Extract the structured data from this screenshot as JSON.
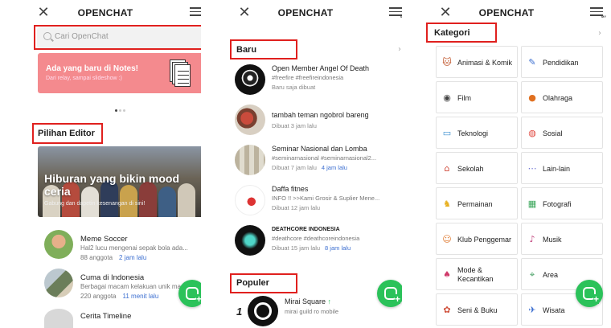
{
  "app_title": "OPENCHAT",
  "menu_badge": "MY",
  "close_glyph": "✕",
  "colors": {
    "accent_green": "#2bc25a",
    "banner_pink": "#f48a8e",
    "link_blue": "#3b6ed0",
    "highlight_red": "#e0201e"
  },
  "panel1": {
    "search_placeholder": "Cari OpenChat",
    "banner_title": "Ada yang baru di Notes!",
    "banner_subtitle": "Dari relay, sampai slideshow :)",
    "editor_title": "Pilihan Editor",
    "hero_title": "Hiburan yang bikin mood ceria",
    "hero_subtitle": "Gabung dan dapetin kesenangan di sini!",
    "rooms": [
      {
        "name": "Meme Soccer",
        "desc": "Hal2 lucu mengenai sepak bola ada...",
        "members": "88 anggota",
        "ago": "2 jam lalu"
      },
      {
        "name": "Cuma di Indonesia",
        "desc": "Berbagai macam kelakuan unik ma...",
        "members": "220 anggota",
        "ago": "11 menit lalu"
      },
      {
        "name": "Cerita Timeline",
        "desc": "",
        "members": "",
        "ago": ""
      }
    ]
  },
  "panel2": {
    "new_title": "Baru",
    "popular_title": "Populer",
    "chevron": "›",
    "new_items": [
      {
        "name": "Open Member Angel Of Death",
        "tags": "#freefire #freefireindonesia",
        "meta": "Baru saja dibuat",
        "ago": ""
      },
      {
        "name": "tambah teman ngobrol bareng",
        "tags": "",
        "meta": "Dibuat 3 jam lalu",
        "ago": ""
      },
      {
        "name": "Seminar Nasional dan Lomba",
        "tags": "#seminarnasional #seminarnasional2...",
        "meta": "Dibuat 7 jam lalu",
        "ago": "4 jam lalu"
      },
      {
        "name": "Daffa fitnes",
        "tags": "INFO !! >>Kami Grosir & Suplier Mene...",
        "meta": "Dibuat 12 jam lalu",
        "ago": ""
      },
      {
        "name": "DEATHCORE INDONESIA",
        "tags": "#deathcore #deathcoreindonesia",
        "meta": "Dibuat 15 jam lalu",
        "ago": "8 jam lalu"
      }
    ],
    "popular_items": [
      {
        "rank": "1",
        "name": "Mirai Square",
        "trend": "↑",
        "desc": "mirai guild ro mobile"
      }
    ]
  },
  "panel3": {
    "category_title": "Kategori",
    "chevron": "›",
    "categories": [
      {
        "label": "Animasi & Komik",
        "icon": "cat-face-icon",
        "glyph": "🐱"
      },
      {
        "label": "Pendidikan",
        "icon": "pencil-icon",
        "glyph": "✎"
      },
      {
        "label": "Film",
        "icon": "film-reel-icon",
        "glyph": "◉"
      },
      {
        "label": "Olahraga",
        "icon": "ball-icon",
        "glyph": "●"
      },
      {
        "label": "Teknologi",
        "icon": "monitor-icon",
        "glyph": "▭"
      },
      {
        "label": "Sosial",
        "icon": "chat-bubble-icon",
        "glyph": "◍"
      },
      {
        "label": "Sekolah",
        "icon": "school-icon",
        "glyph": "⌂"
      },
      {
        "label": "Lain-lain",
        "icon": "more-dots-icon",
        "glyph": "⋯"
      },
      {
        "label": "Permainan",
        "icon": "ghost-icon",
        "glyph": "♞"
      },
      {
        "label": "Fotografi",
        "icon": "photo-icon",
        "glyph": "▦"
      },
      {
        "label": "Klub Penggemar",
        "icon": "fan-face-icon",
        "glyph": "☺"
      },
      {
        "label": "Musik",
        "icon": "music-icon",
        "glyph": "♪"
      },
      {
        "label": "Mode & Kecantikan",
        "icon": "heel-icon",
        "glyph": "♠"
      },
      {
        "label": "Area",
        "icon": "map-pin-icon",
        "glyph": "⌖"
      },
      {
        "label": "Seni & Buku",
        "icon": "palette-icon",
        "glyph": "✿"
      },
      {
        "label": "Wisata",
        "icon": "plane-icon",
        "glyph": "✈"
      }
    ]
  }
}
